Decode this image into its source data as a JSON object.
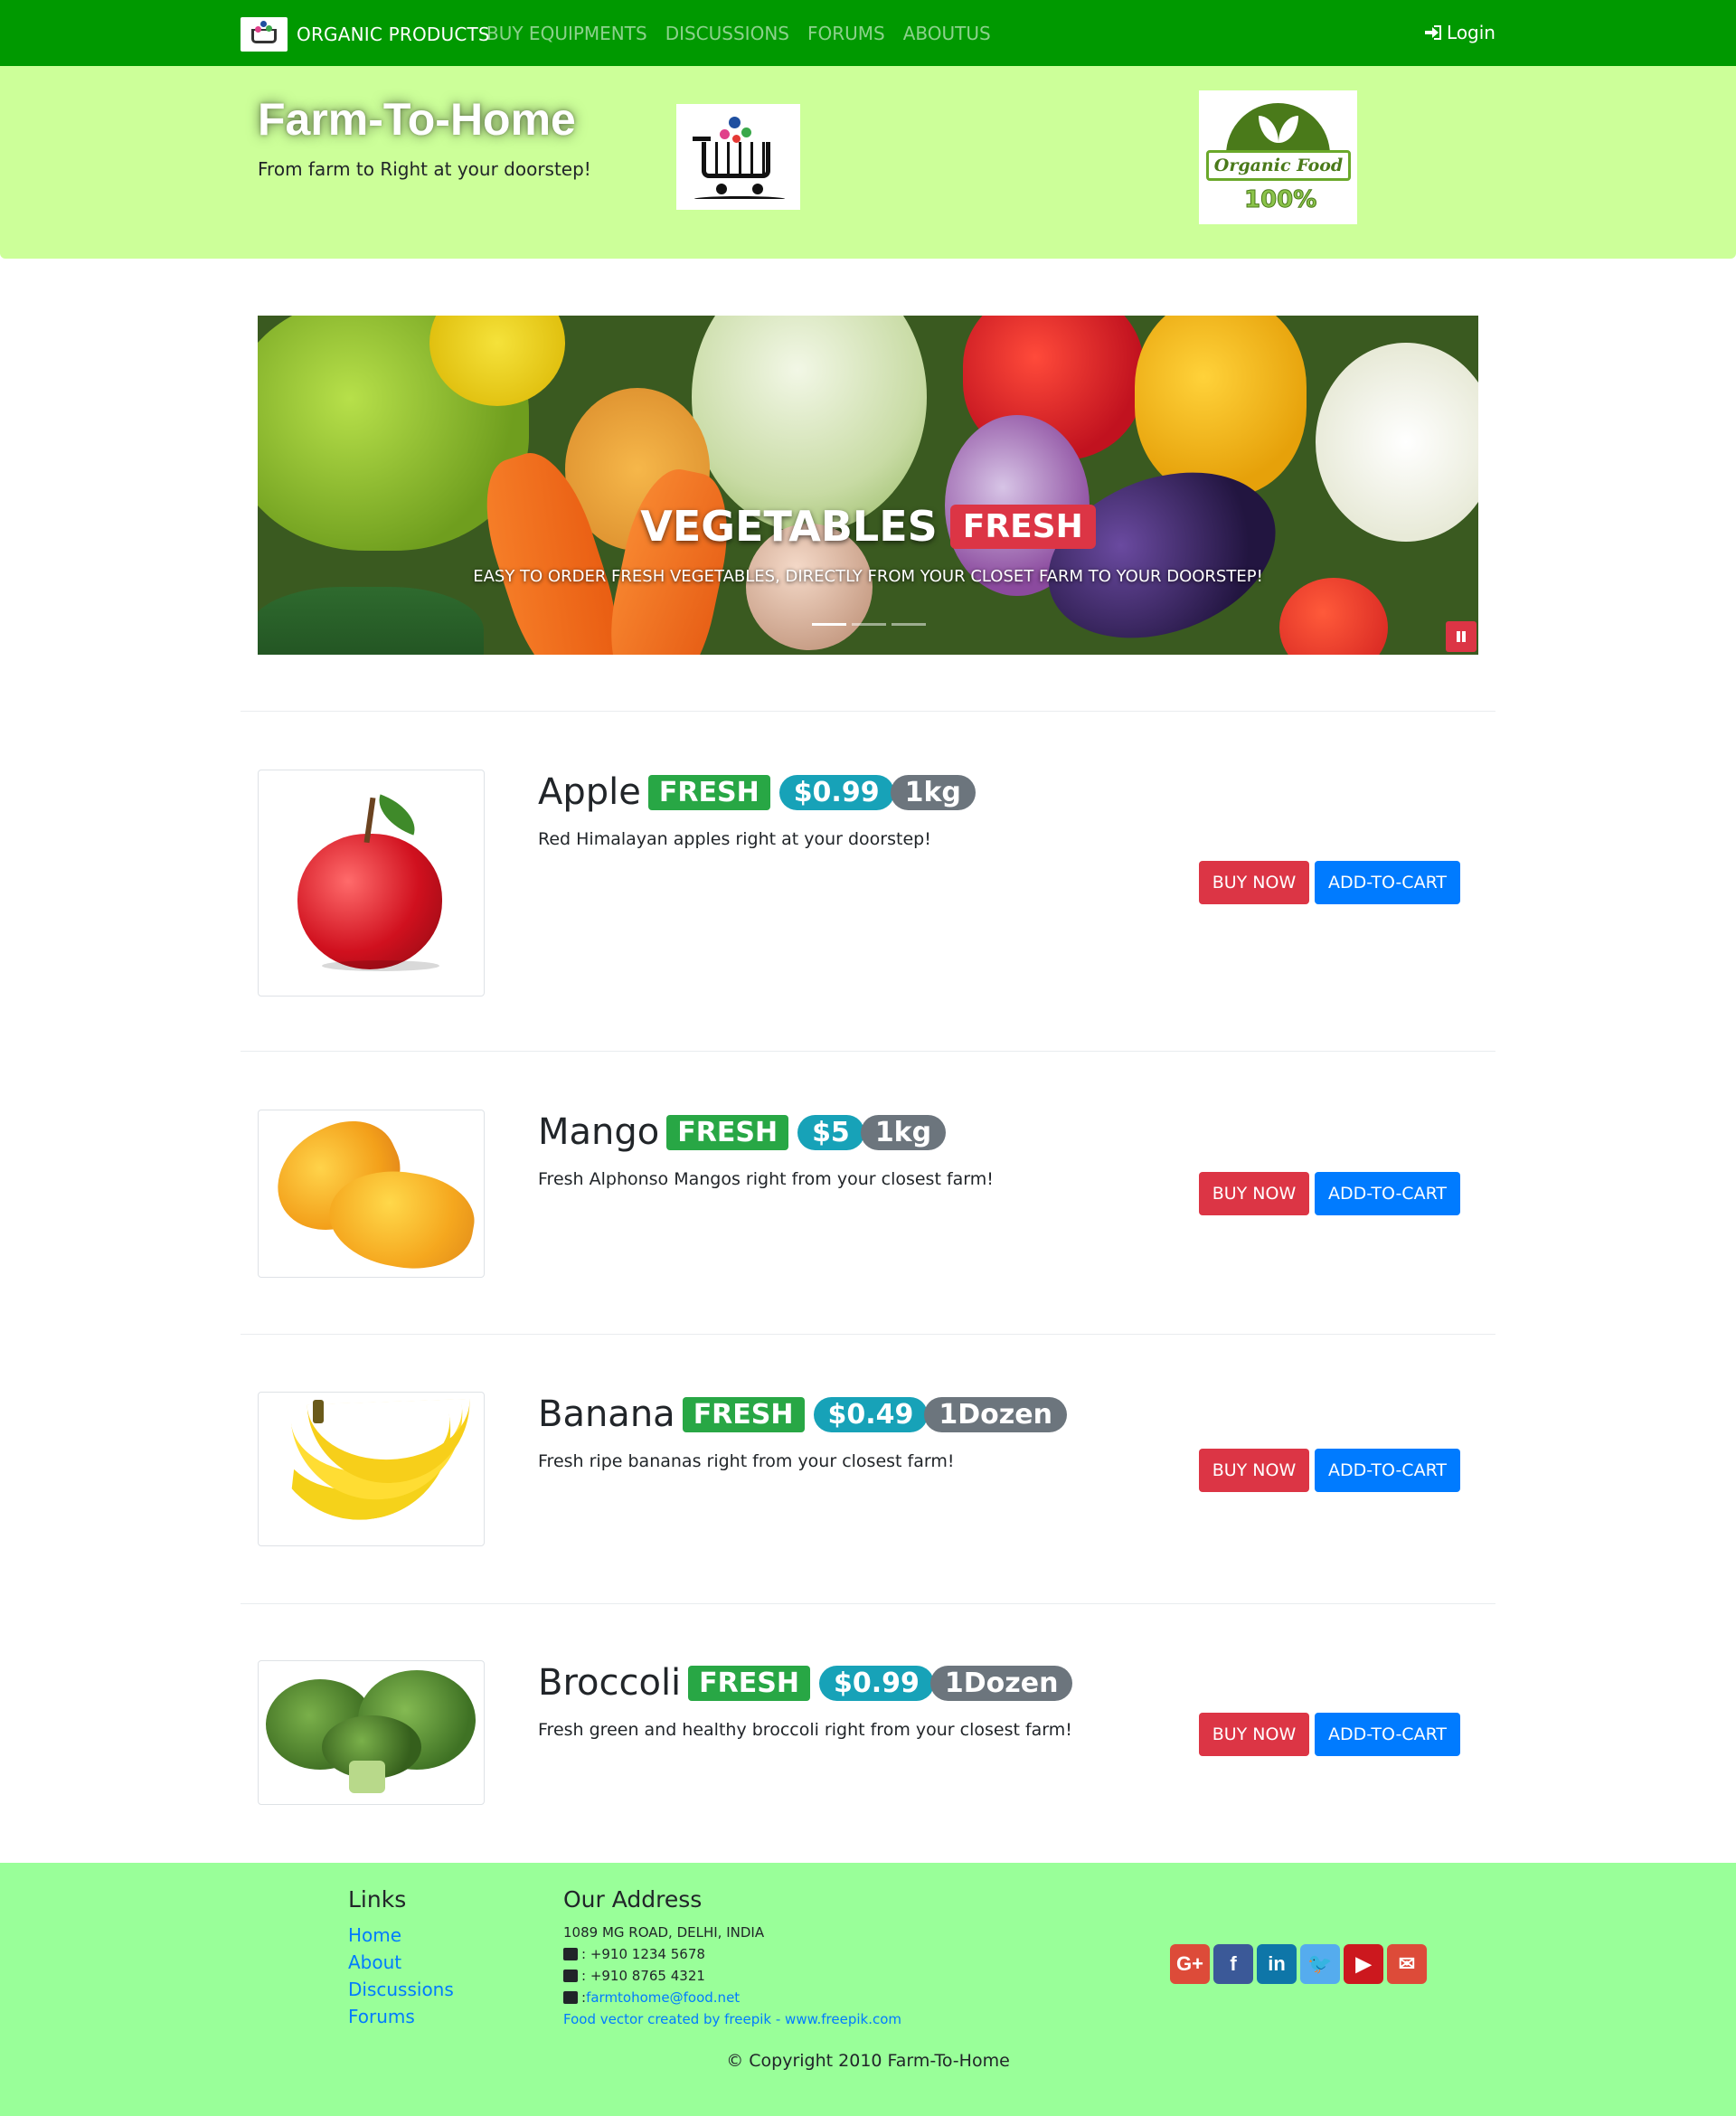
{
  "navbar": {
    "brand": "ORGANIC PRODUCTS",
    "links": [
      "BUY EQUIPMENTS",
      "DISCUSSIONS",
      "FORUMS",
      "ABOUTUS"
    ],
    "login": "Login",
    "color": "#009900"
  },
  "jumbotron": {
    "title": "Farm-To-Home",
    "subtitle": "From farm to Right at your doorstep!",
    "badge_logo_top": "Organic Food",
    "badge_logo_bottom": "100%",
    "color": "#ccff99"
  },
  "carousel": {
    "title": "VEGETABLES",
    "badge": "FRESH",
    "text": "EASY TO ORDER FRESH VEGETABLES, DIRECTLY FROM YOUR CLOSET FARM TO YOUR DOORSTEP!",
    "slides": 3,
    "active_slide": 1
  },
  "products": [
    {
      "name": "Apple",
      "fresh": "FRESH",
      "price": "$0.99",
      "unit": "1kg",
      "description": "Red Himalayan apples right at your doorstep!",
      "buy": "BUY NOW",
      "cart": "ADD-TO-CART"
    },
    {
      "name": "Mango",
      "fresh": "FRESH",
      "price": "$5",
      "unit": "1kg",
      "description": "Fresh Alphonso Mangos right from your closest farm!",
      "buy": "BUY NOW",
      "cart": "ADD-TO-CART"
    },
    {
      "name": "Banana",
      "fresh": "FRESH",
      "price": "$0.49",
      "unit": "1Dozen",
      "description": "Fresh ripe bananas right from your closest farm!",
      "buy": "BUY NOW",
      "cart": "ADD-TO-CART"
    },
    {
      "name": "Broccoli",
      "fresh": "FRESH",
      "price": "$0.99",
      "unit": "1Dozen",
      "description": "Fresh green and healthy broccoli right from your closest farm!",
      "buy": "BUY NOW",
      "cart": "ADD-TO-CART"
    }
  ],
  "footer": {
    "links_heading": "Links",
    "links": [
      "Home",
      "About",
      "Discussions",
      "Forums"
    ],
    "address_heading": "Our Address",
    "address": "1089 MG ROAD, DELHI, INDIA",
    "phone": ": +910 1234 5678",
    "fax": ": +910 8765 4321",
    "email_prefix": ": ",
    "email": "farmtohome@food.net",
    "credit": "Food vector created by freepik - www.freepik.com",
    "socials": [
      {
        "icon": "google-plus-icon",
        "glyph": "G+",
        "color": "#dd4b39"
      },
      {
        "icon": "facebook-icon",
        "glyph": "f",
        "color": "#3b5998"
      },
      {
        "icon": "linkedin-icon",
        "glyph": "in",
        "color": "#0e76a8"
      },
      {
        "icon": "twitter-icon",
        "glyph": "🐦",
        "color": "#55acee"
      },
      {
        "icon": "youtube-icon",
        "glyph": "▶",
        "color": "#cc181e"
      },
      {
        "icon": "mail-icon",
        "glyph": "✉",
        "color": "#dd4b39"
      }
    ],
    "copyright": "© Copyright 2010 Farm-To-Home",
    "color": "#99ff99"
  }
}
